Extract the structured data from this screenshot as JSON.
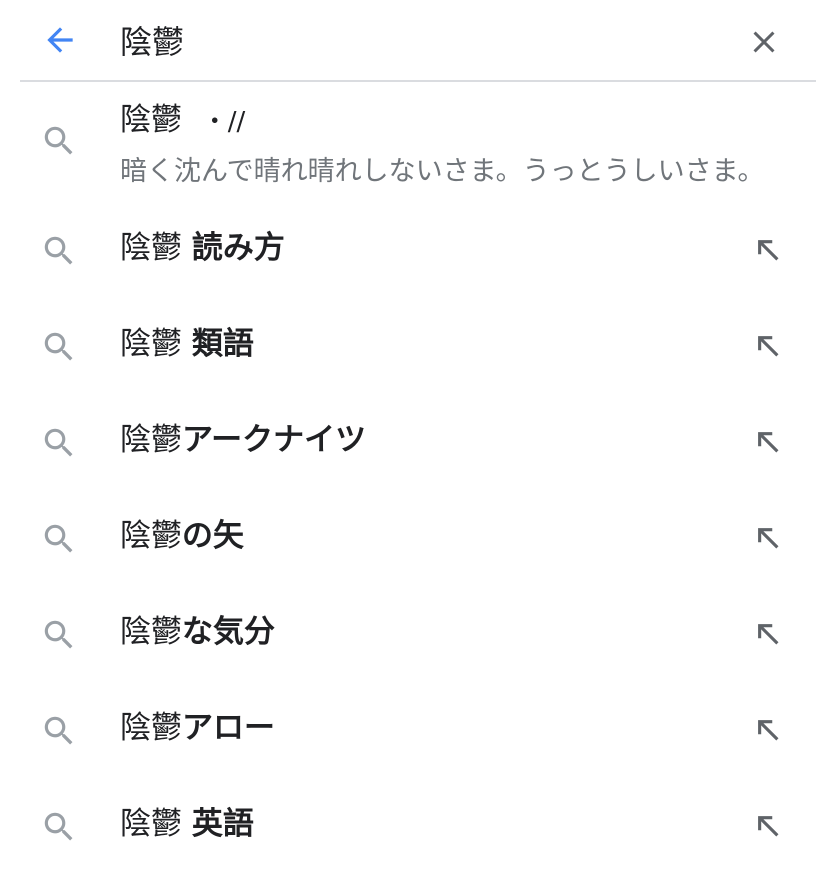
{
  "search": {
    "query": "陰鬱"
  },
  "definition": {
    "term": "陰鬱",
    "reading": "・//",
    "meaning": "暗く沈んで晴れ晴れしないさま。うっとうしいさま。"
  },
  "suggestions": [
    {
      "prefix": "陰鬱 ",
      "completion": "読み方"
    },
    {
      "prefix": "陰鬱 ",
      "completion": "類語"
    },
    {
      "prefix": "陰鬱",
      "completion": "アークナイツ"
    },
    {
      "prefix": "陰鬱",
      "completion": "の矢"
    },
    {
      "prefix": "陰鬱",
      "completion": "な気分"
    },
    {
      "prefix": "陰鬱",
      "completion": "アロー"
    },
    {
      "prefix": "陰鬱 ",
      "completion": "英語"
    }
  ],
  "icons": {
    "back": "arrow-back-icon",
    "clear": "close-icon",
    "search": "search-icon",
    "fill": "arrow-up-left-icon"
  },
  "colors": {
    "accent": "#4285f4",
    "icon_gray": "#5f6368",
    "text": "#202124",
    "secondary_text": "#70757a",
    "divider": "#dadce0"
  }
}
